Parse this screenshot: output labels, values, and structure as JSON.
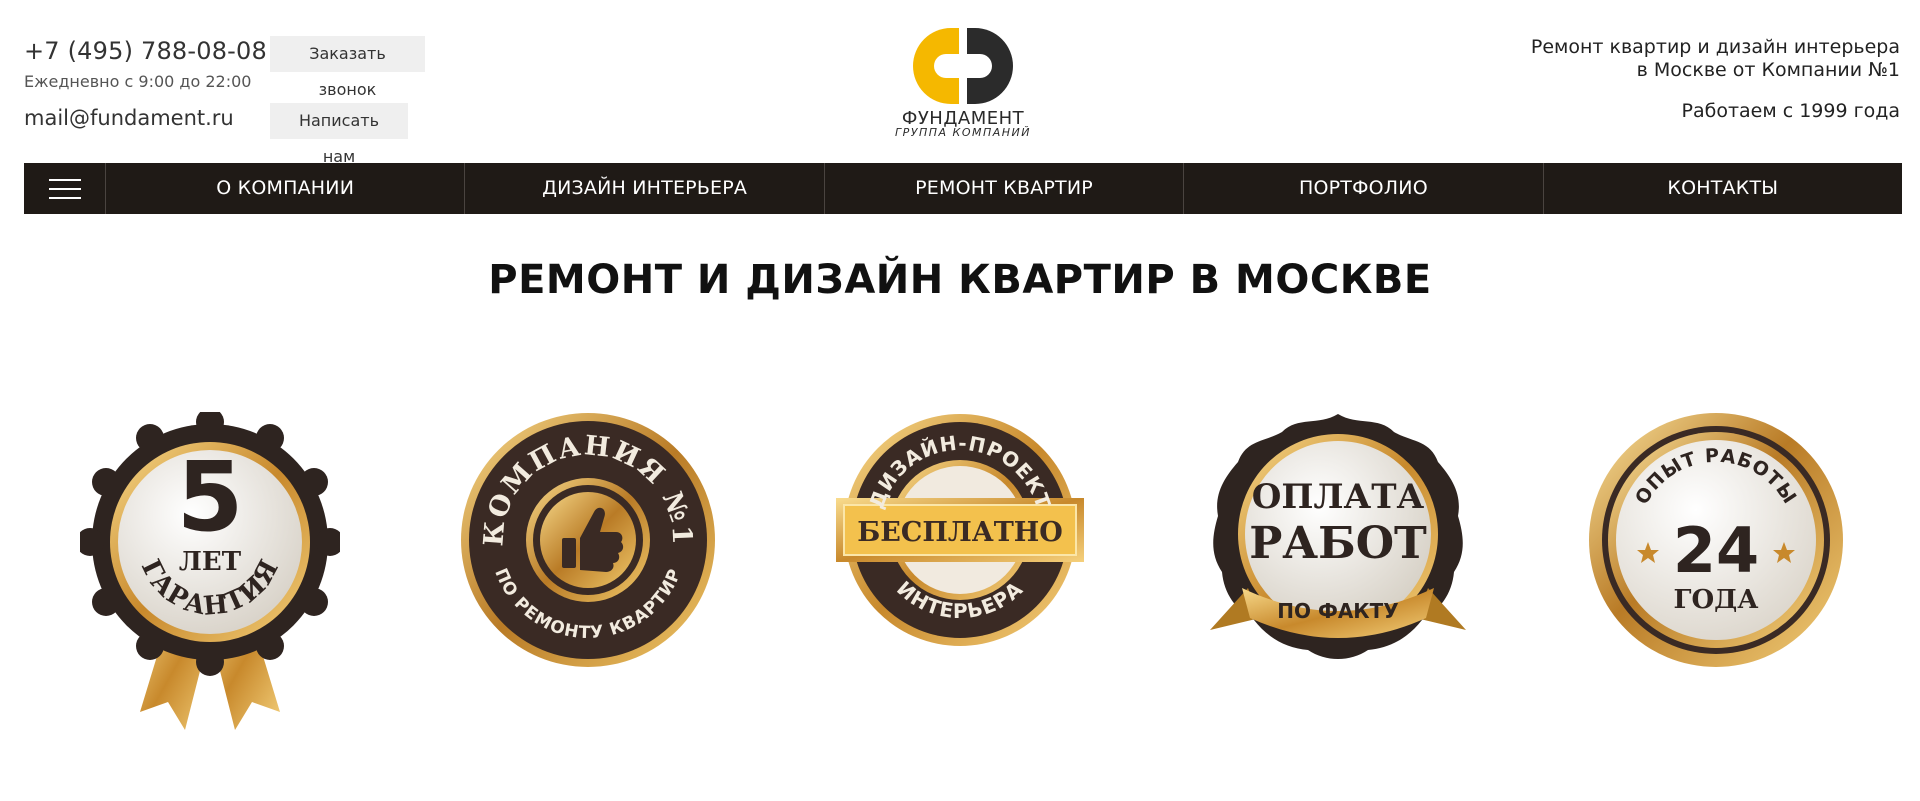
{
  "header": {
    "phone": "+7 (495) 788-08-08",
    "hours": "Ежедневно с 9:00 до 22:00",
    "email": "mail@fundament.ru",
    "call_button": "Заказать звонок",
    "write_button": "Написать нам",
    "logo": {
      "brand": "ФУНДАМЕНТ",
      "subtitle": "ГРУППА КОМПАНИЙ",
      "colors": {
        "yellow": "#f5b800",
        "dark": "#2b2b2b"
      }
    },
    "tagline_line1": "Ремонт квартир и дизайн интерьера",
    "tagline_line2": "в Москве от Компании №1",
    "since": "Работаем с 1999 года"
  },
  "nav": {
    "menu_icon": "hamburger-icon",
    "items": [
      "О КОМПАНИИ",
      "ДИЗАЙН ИНТЕРЬЕРА",
      "РЕМОНТ КВАРТИР",
      "ПОРТФОЛИО",
      "КОНТАКТЫ"
    ]
  },
  "main": {
    "title": "РЕМОНТ И ДИЗАЙН КВАРТИР В МОСКВЕ"
  },
  "badges": {
    "b1": {
      "number": "5",
      "line": "ЛЕТ",
      "arc": "ГАРАНТИЯ"
    },
    "b2": {
      "arc_top": "КОМПАНИЯ №1",
      "arc_bottom": "ПО РЕМОНТУ КВАРТИР",
      "icon": "thumbs-up-icon"
    },
    "b3": {
      "arc_top": "ДИЗАЙН-ПРОЕКТ",
      "ribbon": "БЕСПЛАТНО",
      "arc_bottom": "ИНТЕРЬЕРА"
    },
    "b4": {
      "line1": "ОПЛАТА",
      "line2": "РАБОТ",
      "ribbon": "ПО ФАКТУ"
    },
    "b5": {
      "arc_top": "ОПЫТ РАБОТЫ",
      "number": "24",
      "line": "ГОДА"
    }
  },
  "colors": {
    "nav_bg": "#1f1a16",
    "gold": "#d9a53a",
    "dark_brown": "#3a2a24",
    "cream": "#efe9df"
  }
}
